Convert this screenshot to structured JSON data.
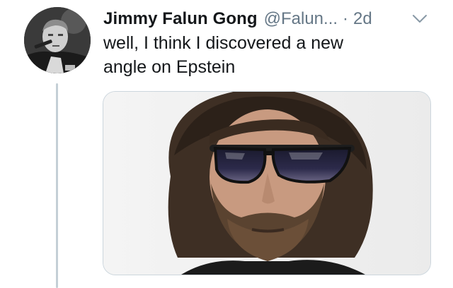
{
  "tweet": {
    "author": {
      "display_name": "Jimmy Falun Gong",
      "handle": "@Falun...",
      "avatar_icon": "profile-photo"
    },
    "separator": "·",
    "timestamp": "2d",
    "menu_icon": "chevron-down-icon",
    "text": "well, I think I discovered a new\nangle on Epstein",
    "media": {
      "type": "photo",
      "description_icon": "photo"
    }
  },
  "colors": {
    "text_primary": "#14171a",
    "text_secondary": "#657786",
    "thread_line": "#c4cfd6",
    "media_border": "#ccd6dd"
  }
}
